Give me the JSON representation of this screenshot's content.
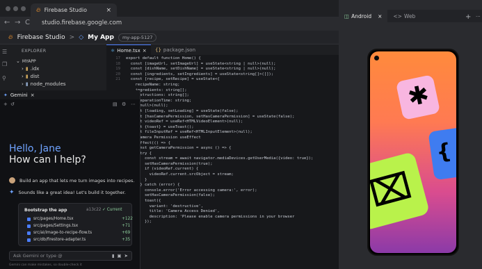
{
  "browser": {
    "tab_title": "Firebase Studio",
    "tab_close": "×",
    "url": "studio.firebase.google.com",
    "back": "←",
    "forward": "→",
    "reload": "C"
  },
  "header": {
    "brand": "Firebase Studio",
    "sep": ">",
    "app_name": "My App",
    "project_pill": "my-app-5127"
  },
  "explorer": {
    "title": "EXPLORER",
    "root": "MYAPP",
    "items": [
      {
        "label": ".idx",
        "kind": "folder"
      },
      {
        "label": "dist",
        "kind": "folder"
      },
      {
        "label": "node_modules",
        "kind": "folder"
      }
    ]
  },
  "editor": {
    "tabs": [
      {
        "label": "Home.tsx",
        "active": true
      },
      {
        "label": "package.json",
        "active": false
      }
    ],
    "lines": [
      {
        "n": "17",
        "t": "export default function Home() {"
      },
      {
        "n": "18",
        "t": "  const [imageUrl, setImageUrl] = useState<string | null>(null);"
      },
      {
        "n": "19",
        "t": "  const [dishName, setDishName] = useState<string | null>(null);"
      },
      {
        "n": "20",
        "t": "  const [ingredients, setIngredients] = useState<string[]>([]);"
      },
      {
        "n": "21",
        "t": "  const [recipe, setRecipe] = useState<{"
      },
      {
        "n": "",
        "t": "    recipeName: string;"
      },
      {
        "n": "",
        "t": "    ingredients: string[];"
      },
      {
        "n": "",
        "t": "    instructions: string[];"
      },
      {
        "n": "",
        "t": "    preparationTime: string;"
      },
      {
        "n": "",
        "t": "  } | null>(null);"
      },
      {
        "n": "",
        "t": "  const [loading, setLoading] = useState(false);"
      },
      {
        "n": "",
        "t": "  const [hasCameraPermission, setHasCameraPermission] = useState(false);"
      },
      {
        "n": "",
        "t": "  const videoRef = useRef<HTMLVideoElement>(null);"
      },
      {
        "n": "",
        "t": "  const {toast} = useToast();"
      },
      {
        "n": "",
        "t": "  const fileInputRef = useRef<HTMLInputElement>(null);"
      },
      {
        "n": "",
        "t": ""
      },
      {
        "n": "",
        "t": "  // Camera Permission useEffect"
      },
      {
        "n": "",
        "t": "  useEffect(() => {"
      },
      {
        "n": "",
        "t": "    const getCameraPermission = async () => {"
      },
      {
        "n": "",
        "t": "      try {"
      },
      {
        "n": "",
        "t": "        const stream = await navigator.mediaDevices.getUserMedia({video: true});"
      },
      {
        "n": "",
        "t": "        setHasCameraPermission(true);"
      },
      {
        "n": "",
        "t": ""
      },
      {
        "n": "",
        "t": "        if (videoRef.current) {"
      },
      {
        "n": "",
        "t": "          videoRef.current.srcObject = stream;"
      },
      {
        "n": "",
        "t": "        }"
      },
      {
        "n": "",
        "t": "      } catch (error) {"
      },
      {
        "n": "",
        "t": "        console.error('Error accessing camera:', error);"
      },
      {
        "n": "",
        "t": "        setHasCameraPermission(false);"
      },
      {
        "n": "",
        "t": "        toast({"
      },
      {
        "n": "",
        "t": "          variant: 'destructive',"
      },
      {
        "n": "",
        "t": "          title: 'Camera Access Denied',"
      },
      {
        "n": "",
        "t": "          description: 'Please enable camera permissions in your browser"
      },
      {
        "n": "",
        "t": "        });"
      }
    ]
  },
  "gemini": {
    "tab_label": "Gemini",
    "tab_close": "×",
    "hello": "Hello, Jane",
    "question": "How can I help?",
    "user_msg": "Build an app that lets me turn images into recipes.",
    "ai_msg": "Sounds like a great idea! Let's build it together.",
    "card": {
      "title": "Bootstrap the app",
      "hash": "a13c22",
      "current": "✓ Current",
      "files": [
        {
          "path": "src/pages/Home.tsx",
          "delta": "+122"
        },
        {
          "path": "src/pages/Settings.tsx",
          "delta": "+71"
        },
        {
          "path": "src/ai/image-to-recipe-flow.ts",
          "delta": "+69"
        },
        {
          "path": "src/db/firestore-adapter.ts",
          "delta": "+35"
        }
      ]
    },
    "input_placeholder": "Ask Gemini or type @",
    "disclaimer": "Gemini can make mistakes, so double-check it"
  },
  "preview": {
    "tabs": [
      {
        "label": "Android",
        "active": true
      },
      {
        "label": "Web",
        "active": false
      }
    ],
    "tab_close": "×",
    "plus": "+",
    "more": "···"
  },
  "colors": {
    "accent": "#4a7dff",
    "gemini_blue": "#6fa3ff",
    "card_pink": "#f8b6e0",
    "card_blue": "#3f7cf0",
    "card_green": "#b9f24b"
  }
}
